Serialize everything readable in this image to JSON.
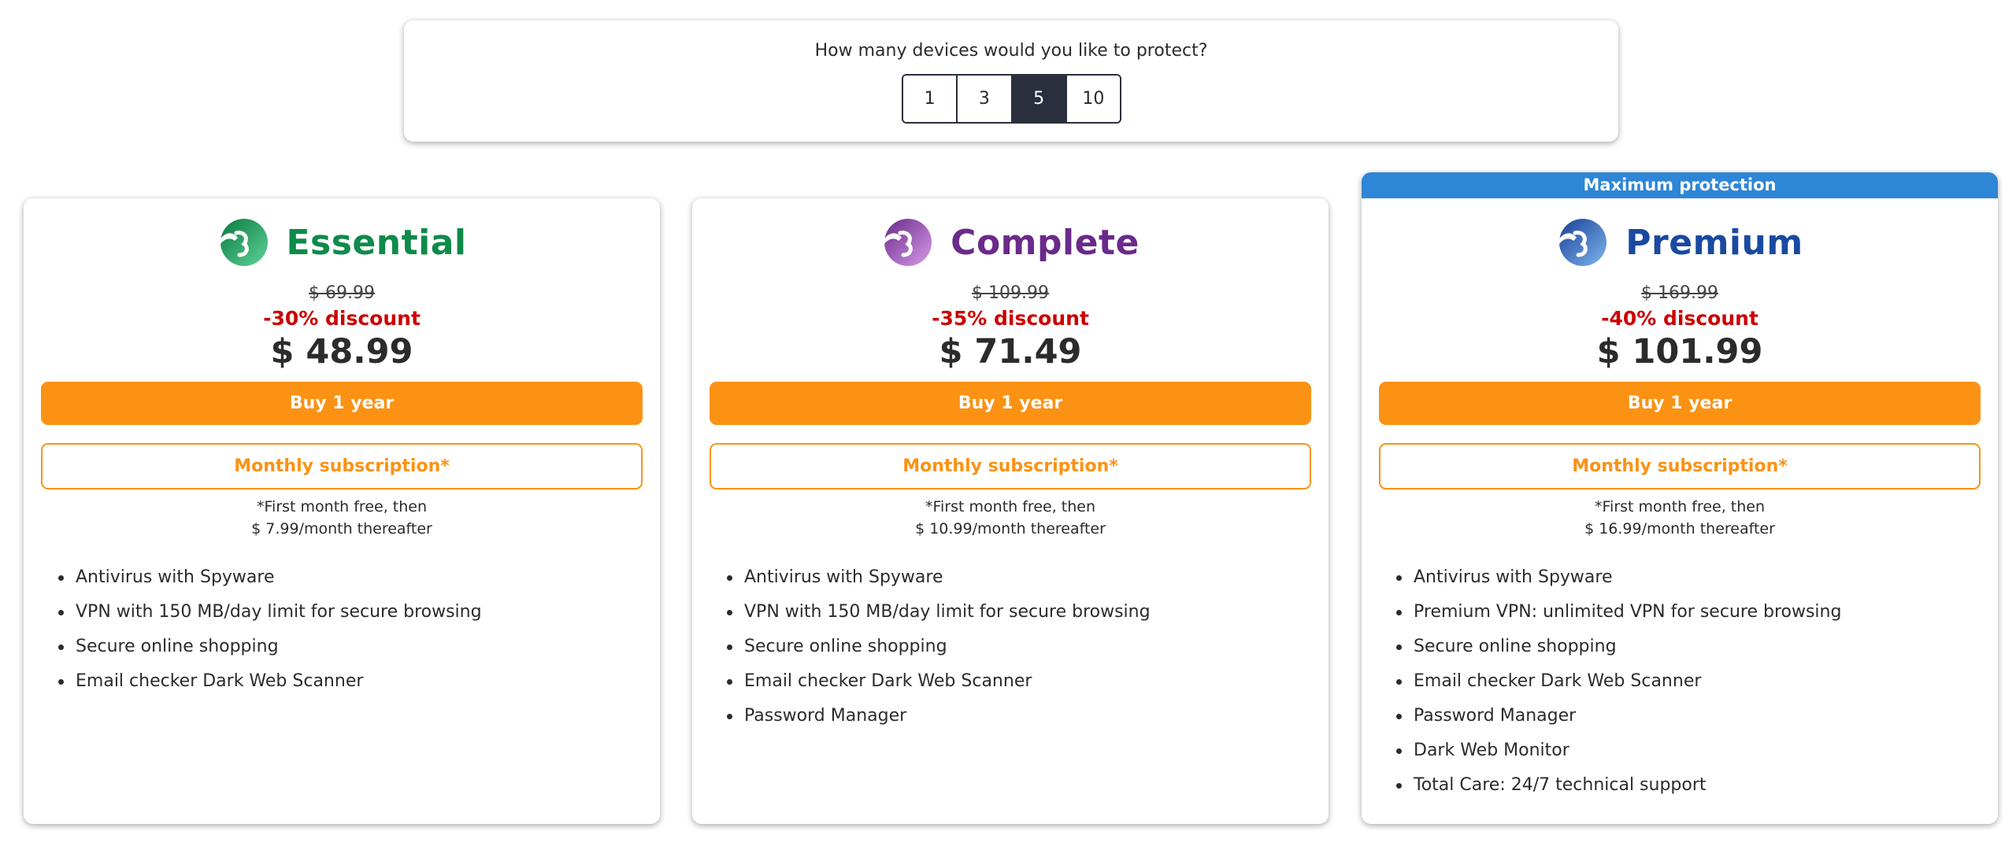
{
  "devices": {
    "question": "How many devices would you like to protect?",
    "options": [
      "1",
      "3",
      "5",
      "10"
    ],
    "selected": "5"
  },
  "colors": {
    "essential": "#0f8a4a",
    "complete": "#6a2a8a",
    "premium": "#1a4aa0",
    "orange": "#fb9214",
    "discount_red": "#cc0000",
    "ribbon_blue": "#2e86d6"
  },
  "plans": [
    {
      "name": "Essential",
      "logo_icon": "essential-logo-icon",
      "old_price": "$ 69.99",
      "discount": "-30% discount",
      "price": "$ 48.99",
      "buy_label": "Buy 1 year",
      "monthly_label": "Monthly subscription*",
      "note_line1": "*First month free, then",
      "note_line2": "$ 7.99/month thereafter",
      "features": [
        "Antivirus with Spyware",
        "VPN with 150 MB/day limit for secure browsing",
        "Secure online shopping",
        "Email checker Dark Web Scanner"
      ]
    },
    {
      "name": "Complete",
      "logo_icon": "complete-logo-icon",
      "old_price": "$ 109.99",
      "discount": "-35% discount",
      "price": "$ 71.49",
      "buy_label": "Buy 1 year",
      "monthly_label": "Monthly subscription*",
      "note_line1": "*First month free, then",
      "note_line2": "$ 10.99/month thereafter",
      "features": [
        "Antivirus with Spyware",
        "VPN with 150 MB/day limit for secure browsing",
        "Secure online shopping",
        "Email checker Dark Web Scanner",
        "Password Manager"
      ]
    },
    {
      "name": "Premium",
      "ribbon": "Maximum protection",
      "logo_icon": "premium-logo-icon",
      "old_price": "$ 169.99",
      "discount": "-40% discount",
      "price": "$ 101.99",
      "buy_label": "Buy 1 year",
      "monthly_label": "Monthly subscription*",
      "note_line1": "*First month free, then",
      "note_line2": "$ 16.99/month thereafter",
      "features": [
        "Antivirus with Spyware",
        "Premium VPN: unlimited VPN for secure browsing",
        "Secure online shopping",
        "Email checker Dark Web Scanner",
        "Password Manager",
        "Dark Web Monitor",
        "Total Care: 24/7 technical support"
      ]
    }
  ]
}
